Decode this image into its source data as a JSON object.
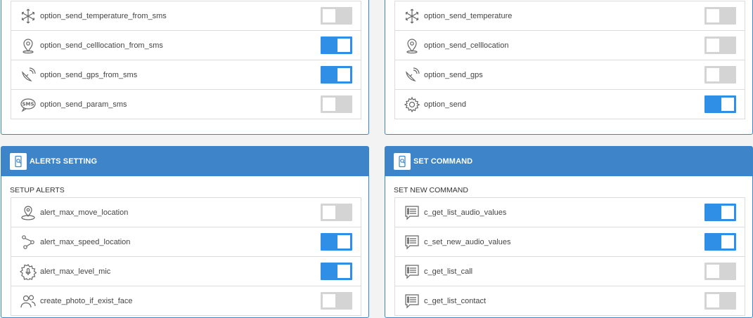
{
  "colors": {
    "accent": "#3d84c8",
    "toggle_on": "#2f8fe6",
    "toggle_off": "#d4d4d4"
  },
  "top_left": {
    "rows": [
      {
        "label": "option_send_temperature_from_sms",
        "icon": "snowflake-icon",
        "on": false
      },
      {
        "label": "option_send_celllocation_from_sms",
        "icon": "location-pin-icon",
        "on": true
      },
      {
        "label": "option_send_gps_from_sms",
        "icon": "satellite-icon",
        "on": true
      },
      {
        "label": "option_send_param_sms",
        "icon": "sms-bubble-icon",
        "on": false
      }
    ]
  },
  "top_right": {
    "rows": [
      {
        "label": "option_send_temperature",
        "icon": "snowflake-icon",
        "on": false
      },
      {
        "label": "option_send_celllocation",
        "icon": "location-pin-icon",
        "on": false
      },
      {
        "label": "option_send_gps",
        "icon": "satellite-icon",
        "on": false
      },
      {
        "label": "option_send",
        "icon": "gear-icon",
        "on": true
      }
    ]
  },
  "alerts": {
    "title": "ALERTS SETTING",
    "section_label": "SETUP ALERTS",
    "rows": [
      {
        "label": "alert_max_move_location",
        "icon": "move-location-icon",
        "on": false
      },
      {
        "label": "alert_max_speed_location",
        "icon": "route-icon",
        "on": true
      },
      {
        "label": "alert_max_level_mic",
        "icon": "mic-level-icon",
        "on": true
      },
      {
        "label": "create_photo_if_exist_face",
        "icon": "faces-icon",
        "on": false
      }
    ]
  },
  "command": {
    "title": "SET COMMAND",
    "section_label": "SET NEW COMMAND",
    "rows": [
      {
        "label": "c_get_list_audio_values",
        "icon": "list-chat-icon",
        "on": true
      },
      {
        "label": "c_set_new_audio_values",
        "icon": "list-chat-icon",
        "on": true
      },
      {
        "label": "c_get_list_call",
        "icon": "list-chat-icon",
        "on": false
      },
      {
        "label": "c_get_list_contact",
        "icon": "list-chat-icon",
        "on": false
      }
    ]
  }
}
